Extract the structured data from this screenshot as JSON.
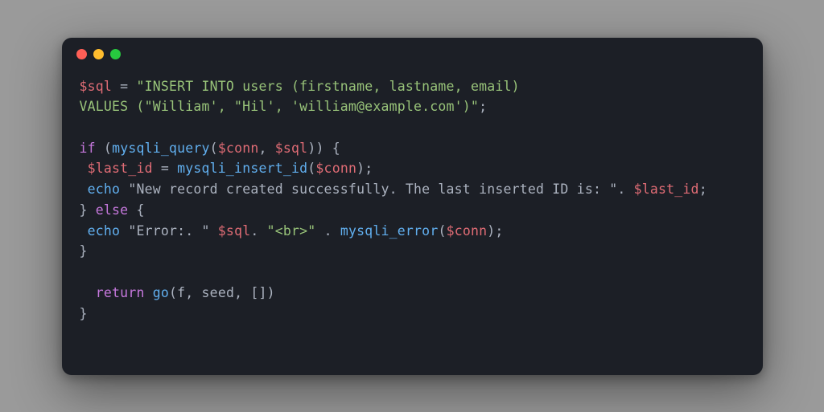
{
  "window": {
    "dots": [
      "red",
      "yellow",
      "green"
    ]
  },
  "code": {
    "line1_a": "$sql",
    "line1_b": " = ",
    "line1_c": "\"INSERT INTO users (firstname, lastname, email)",
    "line2_a": "VALUES (\"William', \"Hil', 'william@example.com')\"",
    "line2_b": ";",
    "line3": "",
    "line4_a": "if",
    "line4_b": " (",
    "line4_c": "mysqli_query",
    "line4_d": "(",
    "line4_e": "$conn",
    "line4_f": ", ",
    "line4_g": "$sql",
    "line4_h": ")) {",
    "line5_a": " ",
    "line5_b": "$last_id",
    "line5_c": " = ",
    "line5_d": "mysqli_insert_id",
    "line5_e": "(",
    "line5_f": "$conn",
    "line5_g": ");",
    "line6_a": " ",
    "line6_b": "echo",
    "line6_c": " \"New record created successfully. The last inserted ID is: \". ",
    "line6_d": "$last_id",
    "line6_e": ";",
    "line7_a": "} ",
    "line7_b": "else",
    "line7_c": " {",
    "line8_a": " ",
    "line8_b": "echo",
    "line8_c": " \"Error:. \" ",
    "line8_d": "$sql",
    "line8_e": ". ",
    "line8_f": "\"<br>\"",
    "line8_g": " . ",
    "line8_h": "mysqli_error",
    "line8_i": "(",
    "line8_j": "$conn",
    "line8_k": ");",
    "line9": "}",
    "line10": "",
    "line11_a": "  ",
    "line11_b": "return",
    "line11_c": " ",
    "line11_d": "go",
    "line11_e": "(f, seed, [])",
    "line12": "}"
  }
}
